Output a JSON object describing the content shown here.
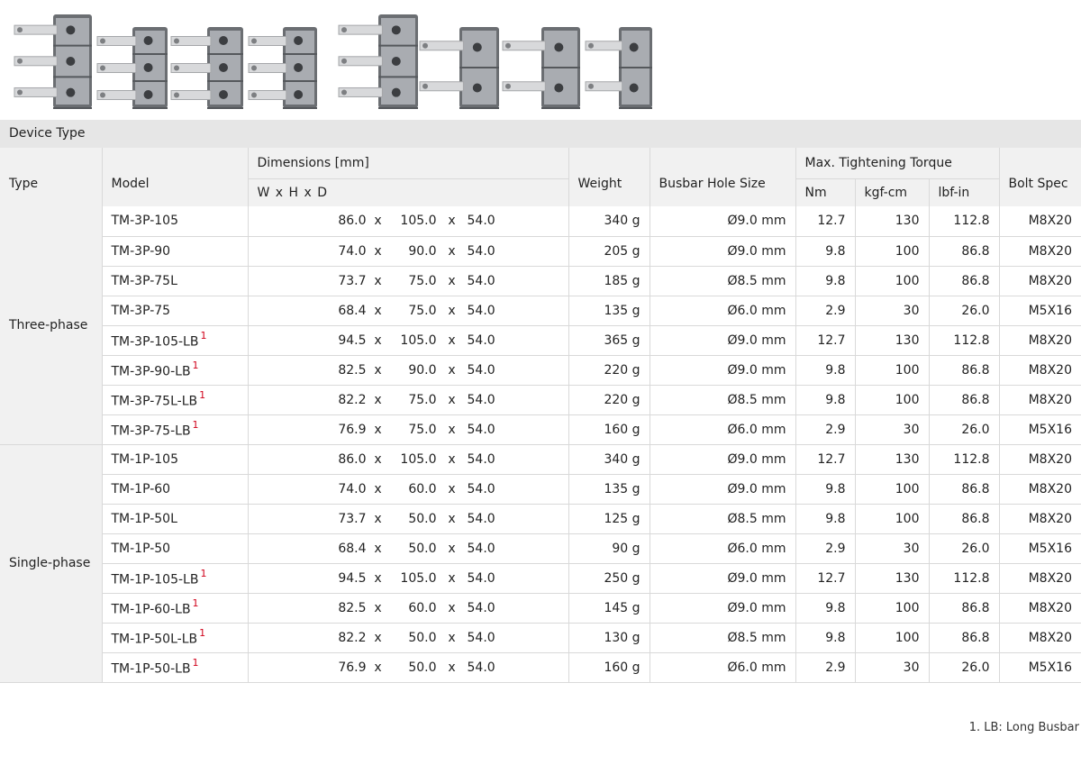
{
  "device_type_label": "Device Type",
  "headers": {
    "type": "Type",
    "model": "Model",
    "dimensions": "Dimensions [mm]",
    "dimensions_sub": "W x H x D",
    "weight": "Weight",
    "busbar_hole": "Busbar Hole Size",
    "torque": "Max. Tightening Torque",
    "torque_nm": "Nm",
    "torque_kgf": "kgf-cm",
    "torque_lbf": "lbf-in",
    "bolt": "Bolt Spec"
  },
  "groups": [
    {
      "type": "Three-phase",
      "rows": [
        {
          "model": "TM-3P-105",
          "fn": "",
          "w": "86.0",
          "h": "105.0",
          "d": "54.0",
          "weight": "340 g",
          "hole": "Ø9.0 mm",
          "nm": "12.7",
          "kgf": "130",
          "lbf": "112.8",
          "bolt": "M8X20"
        },
        {
          "model": "TM-3P-90",
          "fn": "",
          "w": "74.0",
          "h": "90.0",
          "d": "54.0",
          "weight": "205 g",
          "hole": "Ø9.0 mm",
          "nm": "9.8",
          "kgf": "100",
          "lbf": "86.8",
          "bolt": "M8X20"
        },
        {
          "model": "TM-3P-75L",
          "fn": "",
          "w": "73.7",
          "h": "75.0",
          "d": "54.0",
          "weight": "185 g",
          "hole": "Ø8.5 mm",
          "nm": "9.8",
          "kgf": "100",
          "lbf": "86.8",
          "bolt": "M8X20"
        },
        {
          "model": "TM-3P-75",
          "fn": "",
          "w": "68.4",
          "h": "75.0",
          "d": "54.0",
          "weight": "135 g",
          "hole": "Ø6.0 mm",
          "nm": "2.9",
          "kgf": "30",
          "lbf": "26.0",
          "bolt": "M5X16"
        },
        {
          "model": "TM-3P-105-LB",
          "fn": "1",
          "w": "94.5",
          "h": "105.0",
          "d": "54.0",
          "weight": "365 g",
          "hole": "Ø9.0 mm",
          "nm": "12.7",
          "kgf": "130",
          "lbf": "112.8",
          "bolt": "M8X20"
        },
        {
          "model": "TM-3P-90-LB",
          "fn": "1",
          "w": "82.5",
          "h": "90.0",
          "d": "54.0",
          "weight": "220 g",
          "hole": "Ø9.0 mm",
          "nm": "9.8",
          "kgf": "100",
          "lbf": "86.8",
          "bolt": "M8X20"
        },
        {
          "model": "TM-3P-75L-LB",
          "fn": "1",
          "w": "82.2",
          "h": "75.0",
          "d": "54.0",
          "weight": "220 g",
          "hole": "Ø8.5 mm",
          "nm": "9.8",
          "kgf": "100",
          "lbf": "86.8",
          "bolt": "M8X20"
        },
        {
          "model": "TM-3P-75-LB",
          "fn": "1",
          "w": "76.9",
          "h": "75.0",
          "d": "54.0",
          "weight": "160 g",
          "hole": "Ø6.0 mm",
          "nm": "2.9",
          "kgf": "30",
          "lbf": "26.0",
          "bolt": "M5X16"
        }
      ]
    },
    {
      "type": "Single-phase",
      "rows": [
        {
          "model": "TM-1P-105",
          "fn": "",
          "w": "86.0",
          "h": "105.0",
          "d": "54.0",
          "weight": "340 g",
          "hole": "Ø9.0 mm",
          "nm": "12.7",
          "kgf": "130",
          "lbf": "112.8",
          "bolt": "M8X20"
        },
        {
          "model": "TM-1P-60",
          "fn": "",
          "w": "74.0",
          "h": "60.0",
          "d": "54.0",
          "weight": "135 g",
          "hole": "Ø9.0 mm",
          "nm": "9.8",
          "kgf": "100",
          "lbf": "86.8",
          "bolt": "M8X20"
        },
        {
          "model": "TM-1P-50L",
          "fn": "",
          "w": "73.7",
          "h": "50.0",
          "d": "54.0",
          "weight": "125 g",
          "hole": "Ø8.5 mm",
          "nm": "9.8",
          "kgf": "100",
          "lbf": "86.8",
          "bolt": "M8X20"
        },
        {
          "model": "TM-1P-50",
          "fn": "",
          "w": "68.4",
          "h": "50.0",
          "d": "54.0",
          "weight": "90 g",
          "hole": "Ø6.0 mm",
          "nm": "2.9",
          "kgf": "30",
          "lbf": "26.0",
          "bolt": "M5X16"
        },
        {
          "model": "TM-1P-105-LB",
          "fn": "1",
          "w": "94.5",
          "h": "105.0",
          "d": "54.0",
          "weight": "250 g",
          "hole": "Ø9.0 mm",
          "nm": "12.7",
          "kgf": "130",
          "lbf": "112.8",
          "bolt": "M8X20"
        },
        {
          "model": "TM-1P-60-LB",
          "fn": "1",
          "w": "82.5",
          "h": "60.0",
          "d": "54.0",
          "weight": "145 g",
          "hole": "Ø9.0 mm",
          "nm": "9.8",
          "kgf": "100",
          "lbf": "86.8",
          "bolt": "M8X20"
        },
        {
          "model": "TM-1P-50L-LB",
          "fn": "1",
          "w": "82.2",
          "h": "50.0",
          "d": "54.0",
          "weight": "130 g",
          "hole": "Ø8.5 mm",
          "nm": "9.8",
          "kgf": "100",
          "lbf": "86.8",
          "bolt": "M8X20"
        },
        {
          "model": "TM-1P-50-LB",
          "fn": "1",
          "w": "76.9",
          "h": "50.0",
          "d": "54.0",
          "weight": "160 g",
          "hole": "Ø6.0 mm",
          "nm": "2.9",
          "kgf": "30",
          "lbf": "26.0",
          "bolt": "M5X16"
        }
      ]
    }
  ],
  "dim_separator": "x",
  "footnote": "1. LB: Long Busbar",
  "colors": {
    "footnote_marker": "#d0021b",
    "header_bg": "#f1f1f1",
    "bar_bg": "#e6e6e6"
  }
}
